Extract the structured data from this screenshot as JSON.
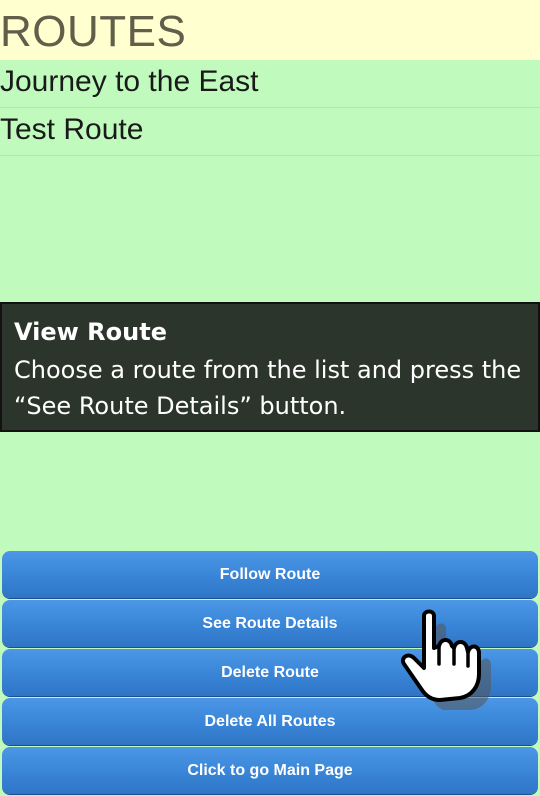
{
  "header": {
    "title": "ROUTES"
  },
  "routes": [
    {
      "label": "Journey to the East"
    },
    {
      "label": "Test Route"
    }
  ],
  "tooltip": {
    "title": "View Route",
    "text": "Choose a route from the list and press the “See Route Details” button."
  },
  "buttons": {
    "follow_route": "Follow Route",
    "see_route_details": "See Route Details",
    "delete_route": "Delete Route",
    "delete_all_routes": "Delete All Routes",
    "main_page": "Click to go Main Page"
  },
  "colors": {
    "background": "#c0fbbd",
    "header_background": "#ffffd0",
    "button_blue": "#3a86d8",
    "tooltip_background": "#2b352b"
  },
  "icons": {
    "pointer": "hand-pointer-icon"
  }
}
